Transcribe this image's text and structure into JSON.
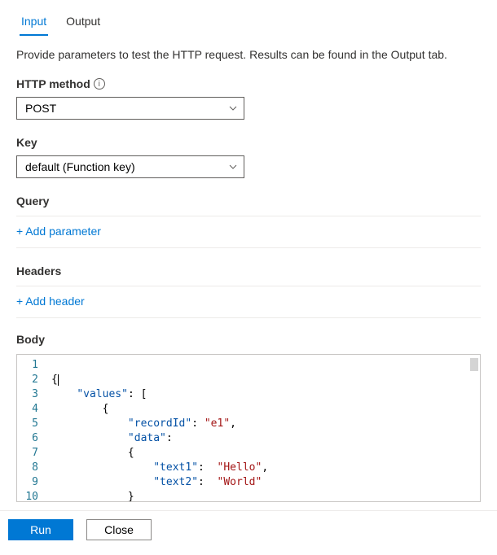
{
  "tabs": {
    "input": "Input",
    "output": "Output"
  },
  "description": "Provide parameters to test the HTTP request. Results can be found in the Output tab.",
  "http_method": {
    "label": "HTTP method",
    "value": "POST"
  },
  "key": {
    "label": "Key",
    "value": "default (Function key)"
  },
  "query": {
    "label": "Query",
    "add_link": "+ Add parameter"
  },
  "headers": {
    "label": "Headers",
    "add_link": "+ Add header"
  },
  "body": {
    "label": "Body",
    "lines": [
      "1",
      "2",
      "3",
      "4",
      "5",
      "6",
      "7",
      "8",
      "9",
      "10"
    ],
    "tokens": {
      "l1": "{",
      "l2_key": "\"values\"",
      "l2_rest": ": [",
      "l3": "{",
      "l4_key": "\"recordId\"",
      "l4_mid": ": ",
      "l4_val": "\"e1\"",
      "l4_end": ",",
      "l5_key": "\"data\"",
      "l5_rest": ":",
      "l6": "{",
      "l7_key": "\"text1\"",
      "l7_mid": ":  ",
      "l7_val": "\"Hello\"",
      "l7_end": ",",
      "l8_key": "\"text2\"",
      "l8_mid": ":  ",
      "l8_val": "\"World\"",
      "l9": "}",
      "l10": "},"
    }
  },
  "footer": {
    "run": "Run",
    "close": "Close"
  }
}
